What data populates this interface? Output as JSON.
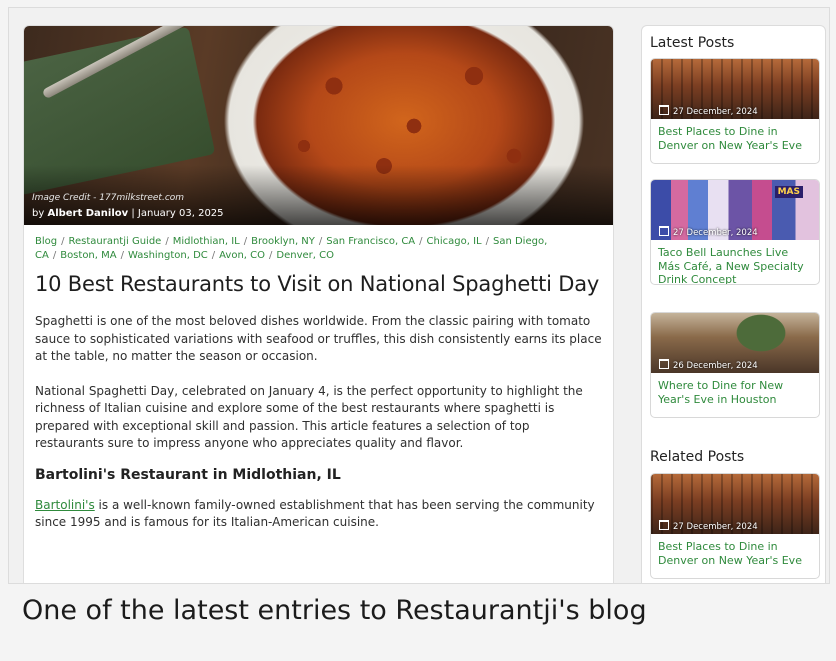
{
  "article": {
    "image_credit": "Image Credit - 177milkstreet.com",
    "byline_prefix": "by ",
    "author": "Albert Danilov",
    "byline_sep": " | ",
    "date": "January 03, 2025",
    "breadcrumbs": [
      "Blog",
      "Restaurantji Guide",
      "Midlothian, IL",
      "Brooklyn, NY",
      "San Francisco, CA",
      "Chicago, IL",
      "San Diego, CA",
      "Boston, MA",
      "Washington, DC",
      "Avon, CO",
      "Denver, CO"
    ],
    "breadcrumb_sep": "/",
    "title": "10 Best Restaurants to Visit on National Spaghetti Day",
    "para1": "Spaghetti is one of the most beloved dishes worldwide. From the classic pairing with tomato sauce to sophisticated variations with seafood or truffles, this dish consistently earns its place at the table, no matter the season or occasion.",
    "para2": "National Spaghetti Day, celebrated on January 4, is the perfect opportunity to highlight the richness of Italian cuisine and explore some of the best restaurants where spaghetti is prepared with exceptional skill and passion. This article features a selection of top restaurants sure to impress anyone who appreciates quality and flavor.",
    "section1_heading": "Bartolini's Restaurant in Midlothian, IL",
    "section1_link": "Bartolini's",
    "section1_text": " is a well-known family-owned establishment that has been serving the community since 1995 and is famous for its Italian-American cuisine."
  },
  "sidebar": {
    "latest_title": "Latest Posts",
    "related_title": "Related Posts",
    "latest": [
      {
        "date": "27 December, 2024",
        "title": "Best Places to Dine in Denver on New Year's Eve"
      },
      {
        "date": "27 December, 2024",
        "title": "Taco Bell Launches Live Más Café, a New Specialty Drink Concept",
        "badge": "MAS"
      },
      {
        "date": "26 December, 2024",
        "title": "Where to Dine for New Year's Eve in Houston"
      }
    ],
    "related": [
      {
        "date": "27 December, 2024",
        "title": "Best Places to Dine in Denver on New Year's Eve"
      }
    ]
  },
  "caption": "One of the latest entries to Restaurantji's blog"
}
